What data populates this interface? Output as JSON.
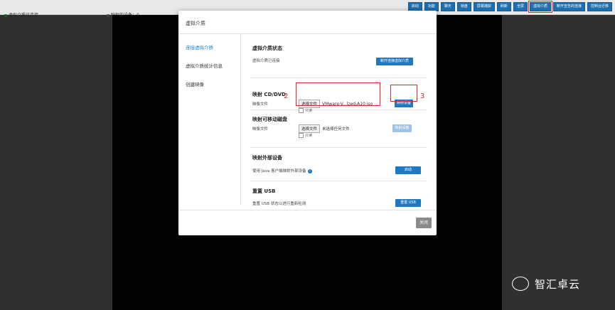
{
  "status_bar": {
    "vm_connected": "虚拟介质已连接",
    "mapped_devices": "映射的设备：0"
  },
  "toolbar": {
    "buttons": [
      "启动",
      "功能",
      "聊天",
      "锁盘",
      "屏幕捕获",
      "刷新",
      "全屏",
      "虚拟介质",
      "断开宣告的连接",
      "控制台迁移"
    ],
    "active_index": 7
  },
  "modal": {
    "title": "虚拟介质",
    "sidebar": [
      "连接虚拟介质",
      "虚拟介质统计信息",
      "创建映像"
    ],
    "vm_status": {
      "title": "虚拟介质状态",
      "text": "虚拟介质已连接",
      "button": "断开连接虚拟介质"
    },
    "map_cd": {
      "title": "映射 CD/DVD",
      "label": "映像文件",
      "choose": "选择文件",
      "file": "VMware-V...lzed-A10.iso",
      "readonly": "只读",
      "button": "映射设备"
    },
    "map_removable": {
      "title": "映射可移动磁盘",
      "label": "映像文件",
      "choose": "选择文件",
      "file": "未选择任何文件",
      "readonly": "只读",
      "button": "映射设备"
    },
    "map_external": {
      "title": "映射外部设备",
      "text": "使用 Java 客户端映射外部设备",
      "button": "启动"
    },
    "reset_usb": {
      "title": "重置 USB",
      "text": "重置 USB 状态以进行重新检测",
      "button": "重置 USB"
    },
    "close": "关闭"
  },
  "annotations": [
    "2",
    "3"
  ],
  "watermark": "智汇卓云"
}
